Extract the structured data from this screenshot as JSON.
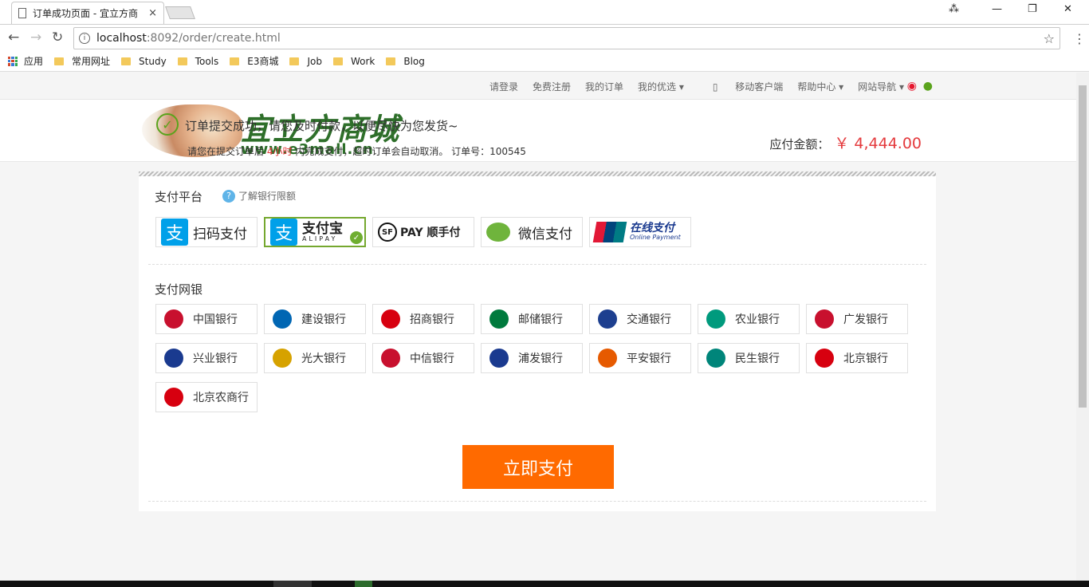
{
  "browser": {
    "tab_title": "订单成功页面 - 宜立方商",
    "tab_close": "×",
    "url_host": "localhost",
    "url_path": ":8092/order/create.html",
    "bookmarks": [
      "应用",
      "常用网址",
      "Study",
      "Tools",
      "E3商城",
      "Job",
      "Work",
      "Blog"
    ]
  },
  "topnav": {
    "items": [
      "请登录",
      "免费注册",
      "我的订单",
      "我的优选 ▾",
      "移动客户端",
      "帮助中心 ▾",
      "网站导航 ▾"
    ]
  },
  "logo": {
    "cn": "宜立方商城",
    "en": "www.e3mall.cn"
  },
  "success": {
    "title": "订单提交成功，请您及时付款，以便尽快为您发货~",
    "sub_prefix": "请您在提交订单后",
    "sub_highlight": "4小时",
    "sub_suffix": "内完成支付，超时订单会自动取消。 订单号：100545",
    "amount_label": "应付金额：",
    "amount_value": "￥ 4,444.00"
  },
  "platform": {
    "title": "支付平台",
    "help": "了解银行限额",
    "items": [
      {
        "label": "扫码支付"
      },
      {
        "label": "支付宝",
        "sub": "ALIPAY"
      },
      {
        "label": "PAY 顺手付"
      },
      {
        "label": "微信支付"
      },
      {
        "label": "在线支付",
        "sub": "Online Payment"
      }
    ]
  },
  "banks": {
    "title": "支付网银",
    "items": [
      "中国银行",
      "建设银行",
      "招商银行",
      "邮储银行",
      "交通银行",
      "农业银行",
      "广发银行",
      "兴业银行",
      "光大银行",
      "中信银行",
      "浦发银行",
      "平安银行",
      "民生银行",
      "北京银行",
      "北京农商行"
    ],
    "colors": [
      "#c8102e",
      "#0066b3",
      "#d7000f",
      "#007a3d",
      "#1d3f8f",
      "#009a7d",
      "#c8102e",
      "#1a3a8f",
      "#d6a200",
      "#c8102e",
      "#1a3a8f",
      "#e65a00",
      "#00857a",
      "#d7000f",
      "#d7000f"
    ]
  },
  "pay_button": "立即支付"
}
